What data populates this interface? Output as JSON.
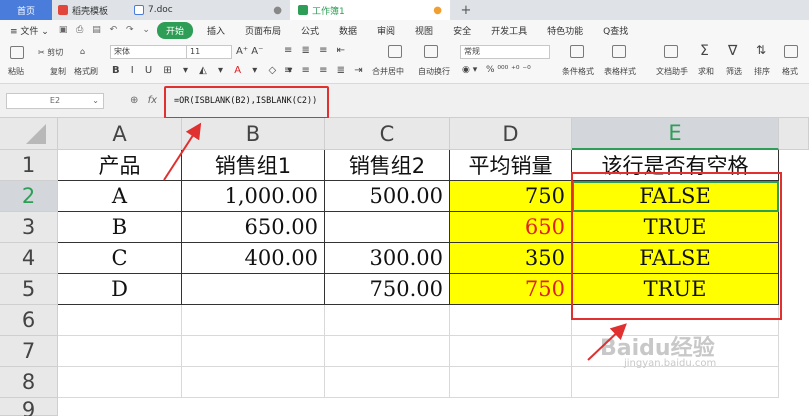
{
  "tabs": {
    "home": "首页",
    "template": "稻壳模板",
    "doc": "7.doc",
    "workbook": "工作簿1",
    "add": "+"
  },
  "menu": {
    "file": "≡ 文件 ⌄",
    "start": "开始",
    "items": [
      "插入",
      "页面布局",
      "公式",
      "数据",
      "审阅",
      "视图",
      "安全",
      "开发工具",
      "特色功能"
    ],
    "search": "Q查找"
  },
  "ribbon": {
    "paste": "粘贴",
    "cut": "✂ 剪切",
    "copy": "复制",
    "format_painter": "格式刷",
    "font_name": "宋体",
    "font_size": "11",
    "number_format": "常规",
    "merge_center": "合并居中",
    "auto_wrap": "自动换行",
    "percent_tools": "% ⁰⁰⁰ ⁺⁰ ⁻⁰",
    "conditional_format": "条件格式",
    "table_style": "表格样式",
    "doc_helper": "文档助手",
    "sum": "求和",
    "filter": "筛选",
    "sort": "排序",
    "format": "格式"
  },
  "formula_bar": {
    "name_box": "E2",
    "fx": "fx",
    "formula": "=OR(ISBLANK(B2),ISBLANK(C2))"
  },
  "sheet": {
    "columns": [
      "A",
      "B",
      "C",
      "D",
      "E"
    ],
    "rows": [
      "1",
      "2",
      "3",
      "4",
      "5",
      "6",
      "7",
      "8",
      "9"
    ],
    "headers": [
      "产品",
      "销售组1",
      "销售组2",
      "平均销量",
      "该行是否有空格"
    ],
    "data": [
      [
        "A",
        "1,000.00",
        "500.00",
        "750",
        "FALSE"
      ],
      [
        "B",
        "650.00",
        "",
        "650",
        "TRUE"
      ],
      [
        "C",
        "400.00",
        "300.00",
        "350",
        "FALSE"
      ],
      [
        "D",
        "",
        "750.00",
        "750",
        "TRUE"
      ]
    ],
    "highlight_color": "#ffff00",
    "red_value_color": "#e02020"
  },
  "watermark": {
    "logo": "Baidu经验",
    "url": "jingyan.baidu.com"
  }
}
